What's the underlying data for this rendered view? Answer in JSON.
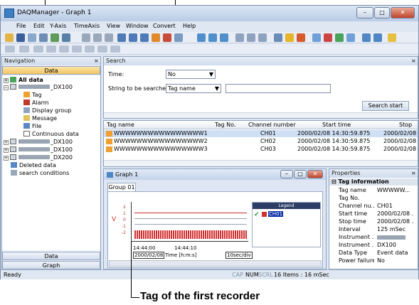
{
  "window": {
    "title": "DAQManager - Graph 1"
  },
  "menu": [
    "File",
    "Edit",
    "Y-Axis",
    "TimeAxis",
    "View",
    "Window",
    "Convert",
    "Help"
  ],
  "navigation": {
    "title": "Navigation",
    "pin": "¤",
    "data_button": "Data",
    "all_data": "All data",
    "recorder1": "_DX100",
    "items": [
      "Tag",
      "Alarm",
      "Display group",
      "Message",
      "File",
      "Continuous data"
    ],
    "recorder2": "_DX100",
    "recorder3": "_DX100",
    "recorder4": "_DX200",
    "deleted": "Deleted data",
    "search_conditions": "search conditions",
    "bottom_data": "Data",
    "bottom_graph": "Graph"
  },
  "search": {
    "title": "Search",
    "pin": "¤",
    "time_label": "Time:",
    "time_value": "No",
    "string_label": "String to be searched:",
    "string_type": "Tag name",
    "string_value": "",
    "button": "Search start"
  },
  "table": {
    "headers": [
      "Tag name",
      "Tag No.",
      "Channel number",
      "Start time",
      "Stop"
    ],
    "rows": [
      [
        "WWWWWWWWWWWWWWWW1",
        "",
        "CH01",
        "2000/02/08 14:30:59.875",
        "2000/02/08"
      ],
      [
        "WWWWWWWWWWWWWWWW2",
        "",
        "CH02",
        "2000/02/08 14:30:59.875",
        "2000/02/08"
      ],
      [
        "WWWWWWWWWWWWWWWW3",
        "",
        "CH03",
        "2000/02/08 14:30:59.875",
        "2000/02/08"
      ]
    ]
  },
  "graph": {
    "title": "Graph 1",
    "tab": "Group 01",
    "legend_title": "Legend",
    "legend_item": "CH01",
    "time1": "14:44:00",
    "time2": "14:44:10",
    "date": "2000/02/08",
    "time_label": "Time [h:m:s]",
    "scale": "10sec/div",
    "y_ticks": [
      "2",
      "1",
      "0",
      "-1",
      "-2"
    ],
    "y_label": "V"
  },
  "properties": {
    "title": "Properties",
    "pin": "¤",
    "section": "Tag information",
    "rows": [
      [
        "Tag name",
        "WWWWW..."
      ],
      [
        "Tag No.",
        ""
      ],
      [
        "Channel nu...",
        "CH01"
      ],
      [
        "Start time",
        "2000/02/08 ..."
      ],
      [
        "Stop time",
        "2000/02/08 ..."
      ],
      [
        "Interval",
        "125 mSec"
      ],
      [
        "Instrument ...",
        ""
      ],
      [
        "Instrument ...",
        "DX100"
      ],
      [
        "Data Type",
        "Event data"
      ],
      [
        "Power failure",
        "No"
      ]
    ]
  },
  "status": {
    "ready": "Ready",
    "cap": "CAP",
    "num": "NUM",
    "scrl": "SCRL",
    "items": "16 Items : 16 mSec"
  },
  "annotation": "Tag of the first recorder",
  "colors": {
    "accent": "#cfe0f5",
    "selection": "#0a2ea8",
    "trace": "#cc2a2a"
  }
}
